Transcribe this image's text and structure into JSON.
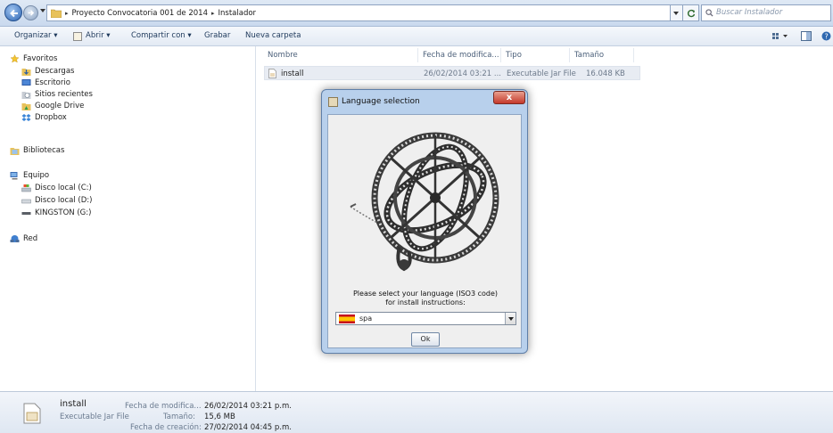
{
  "address_bar": {
    "breadcrumbs": [
      "Proyecto Convocatoria 001 de 2014",
      "Instalador"
    ],
    "search_placeholder": "Buscar Instalador"
  },
  "toolbar": {
    "organize": "Organizar ▾",
    "open": "Abrir ▾",
    "share": "Compartir con ▾",
    "burn": "Grabar",
    "new_folder": "Nueva carpeta"
  },
  "nav": {
    "favorites_label": "Favoritos",
    "favorites": [
      "Descargas",
      "Escritorio",
      "Sitios recientes",
      "Google Drive",
      "Dropbox"
    ],
    "libraries_label": "Bibliotecas",
    "computer_label": "Equipo",
    "drives": [
      "Disco local (C:)",
      "Disco local (D:)",
      "KINGSTON (G:)"
    ],
    "network_label": "Red"
  },
  "file_list": {
    "columns": [
      "Nombre",
      "Fecha de modifica...",
      "Tipo",
      "Tamaño"
    ],
    "rows": [
      {
        "name": "install",
        "modified": "26/02/2014 03:21 ...",
        "type": "Executable Jar File",
        "size": "16.048 KB"
      }
    ]
  },
  "dialog": {
    "title": "Language selection",
    "close": "x",
    "prompt_line1": "Please select your language (ISO3 code)",
    "prompt_line2": "for install instructions:",
    "selected_language": "spa",
    "ok": "Ok"
  },
  "details": {
    "name": "install",
    "type": "Executable Jar File",
    "modified_label": "Fecha de modifica...",
    "modified_value": "26/02/2014 03:21 p.m.",
    "size_label": "Tamaño:",
    "size_value": "15,6 MB",
    "created_label": "Fecha de creación:",
    "created_value": "27/02/2014 04:45 p.m."
  },
  "icons": [
    "back-arrow-icon",
    "forward-arrow-icon",
    "folder-icon",
    "refresh-icon",
    "search-icon",
    "star-icon",
    "library-icon",
    "computer-icon",
    "drive-icon",
    "usb-drive-icon",
    "network-icon",
    "jar-file-icon",
    "spain-flag-icon",
    "armillary-sphere-icon"
  ]
}
